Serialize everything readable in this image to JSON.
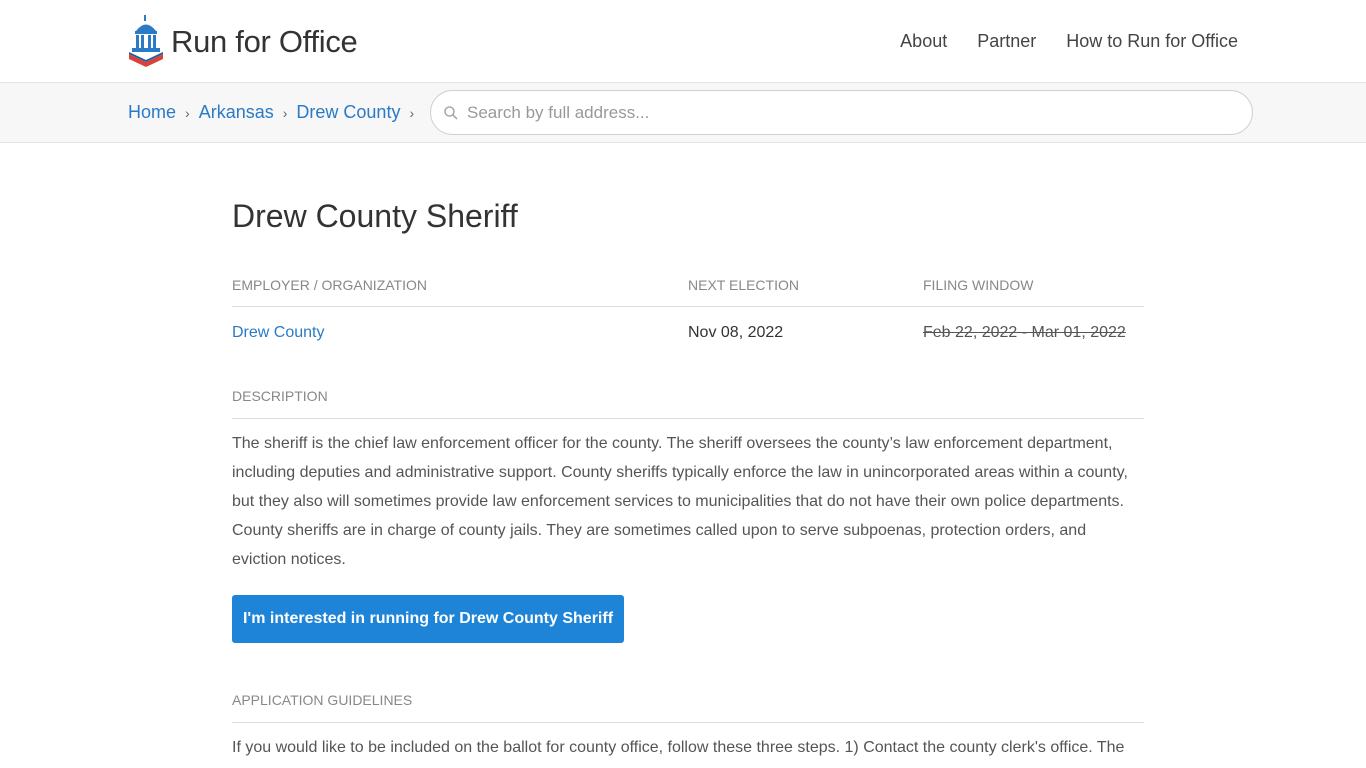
{
  "header": {
    "logo_text": "Run for Office",
    "nav": [
      "About",
      "Partner",
      "How to Run for Office"
    ]
  },
  "breadcrumb": [
    "Home",
    "Arkansas",
    "Drew County"
  ],
  "search": {
    "placeholder": "Search by full address..."
  },
  "page": {
    "title": "Drew County Sheriff",
    "table": {
      "headers": [
        "EMPLOYER / ORGANIZATION",
        "NEXT ELECTION",
        "FILING WINDOW"
      ],
      "row": {
        "employer": "Drew County",
        "next_election": "Nov 08, 2022",
        "filing_window": "Feb 22, 2022 - Mar 01, 2022"
      }
    },
    "description_label": "DESCRIPTION",
    "description": "The sheriff is the chief law enforcement officer for the county. The sheriff oversees the county’s law enforcement department, including deputies and administrative support. County sheriffs typically enforce the law in unincorporated areas within a county, but they also will sometimes provide law enforcement services to municipalities that do not have their own police departments. County sheriffs are in charge of county jails. They are sometimes called upon to serve subpoenas, protection orders, and eviction notices.",
    "cta_label": "I'm interested in running for Drew County Sheriff",
    "guidelines_label": "APPLICATION GUIDELINES",
    "guidelines": "If you would like to be included on the ballot for county office, follow these three steps. 1) Contact the county clerk's office. The"
  },
  "colors": {
    "link": "#2a7ac6",
    "button": "#1d84d8",
    "logo_red": "#d9413a",
    "logo_blue": "#2a7ac6"
  }
}
